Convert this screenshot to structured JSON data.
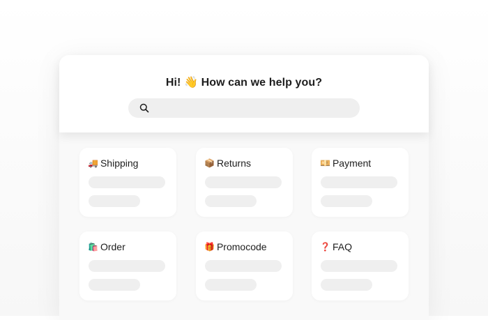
{
  "header": {
    "greeting": "Hi! 👋 How can we help you?",
    "search": {
      "placeholder": "",
      "icon": "search-icon"
    }
  },
  "categories": [
    {
      "emoji": "🚚",
      "label": "Shipping"
    },
    {
      "emoji": "📦",
      "label": "Returns"
    },
    {
      "emoji": "💴",
      "label": "Payment"
    },
    {
      "emoji": "🛍️",
      "label": "Order"
    },
    {
      "emoji": "🎁",
      "label": "Promocode"
    },
    {
      "emoji": "❓",
      "label": "FAQ"
    }
  ]
}
